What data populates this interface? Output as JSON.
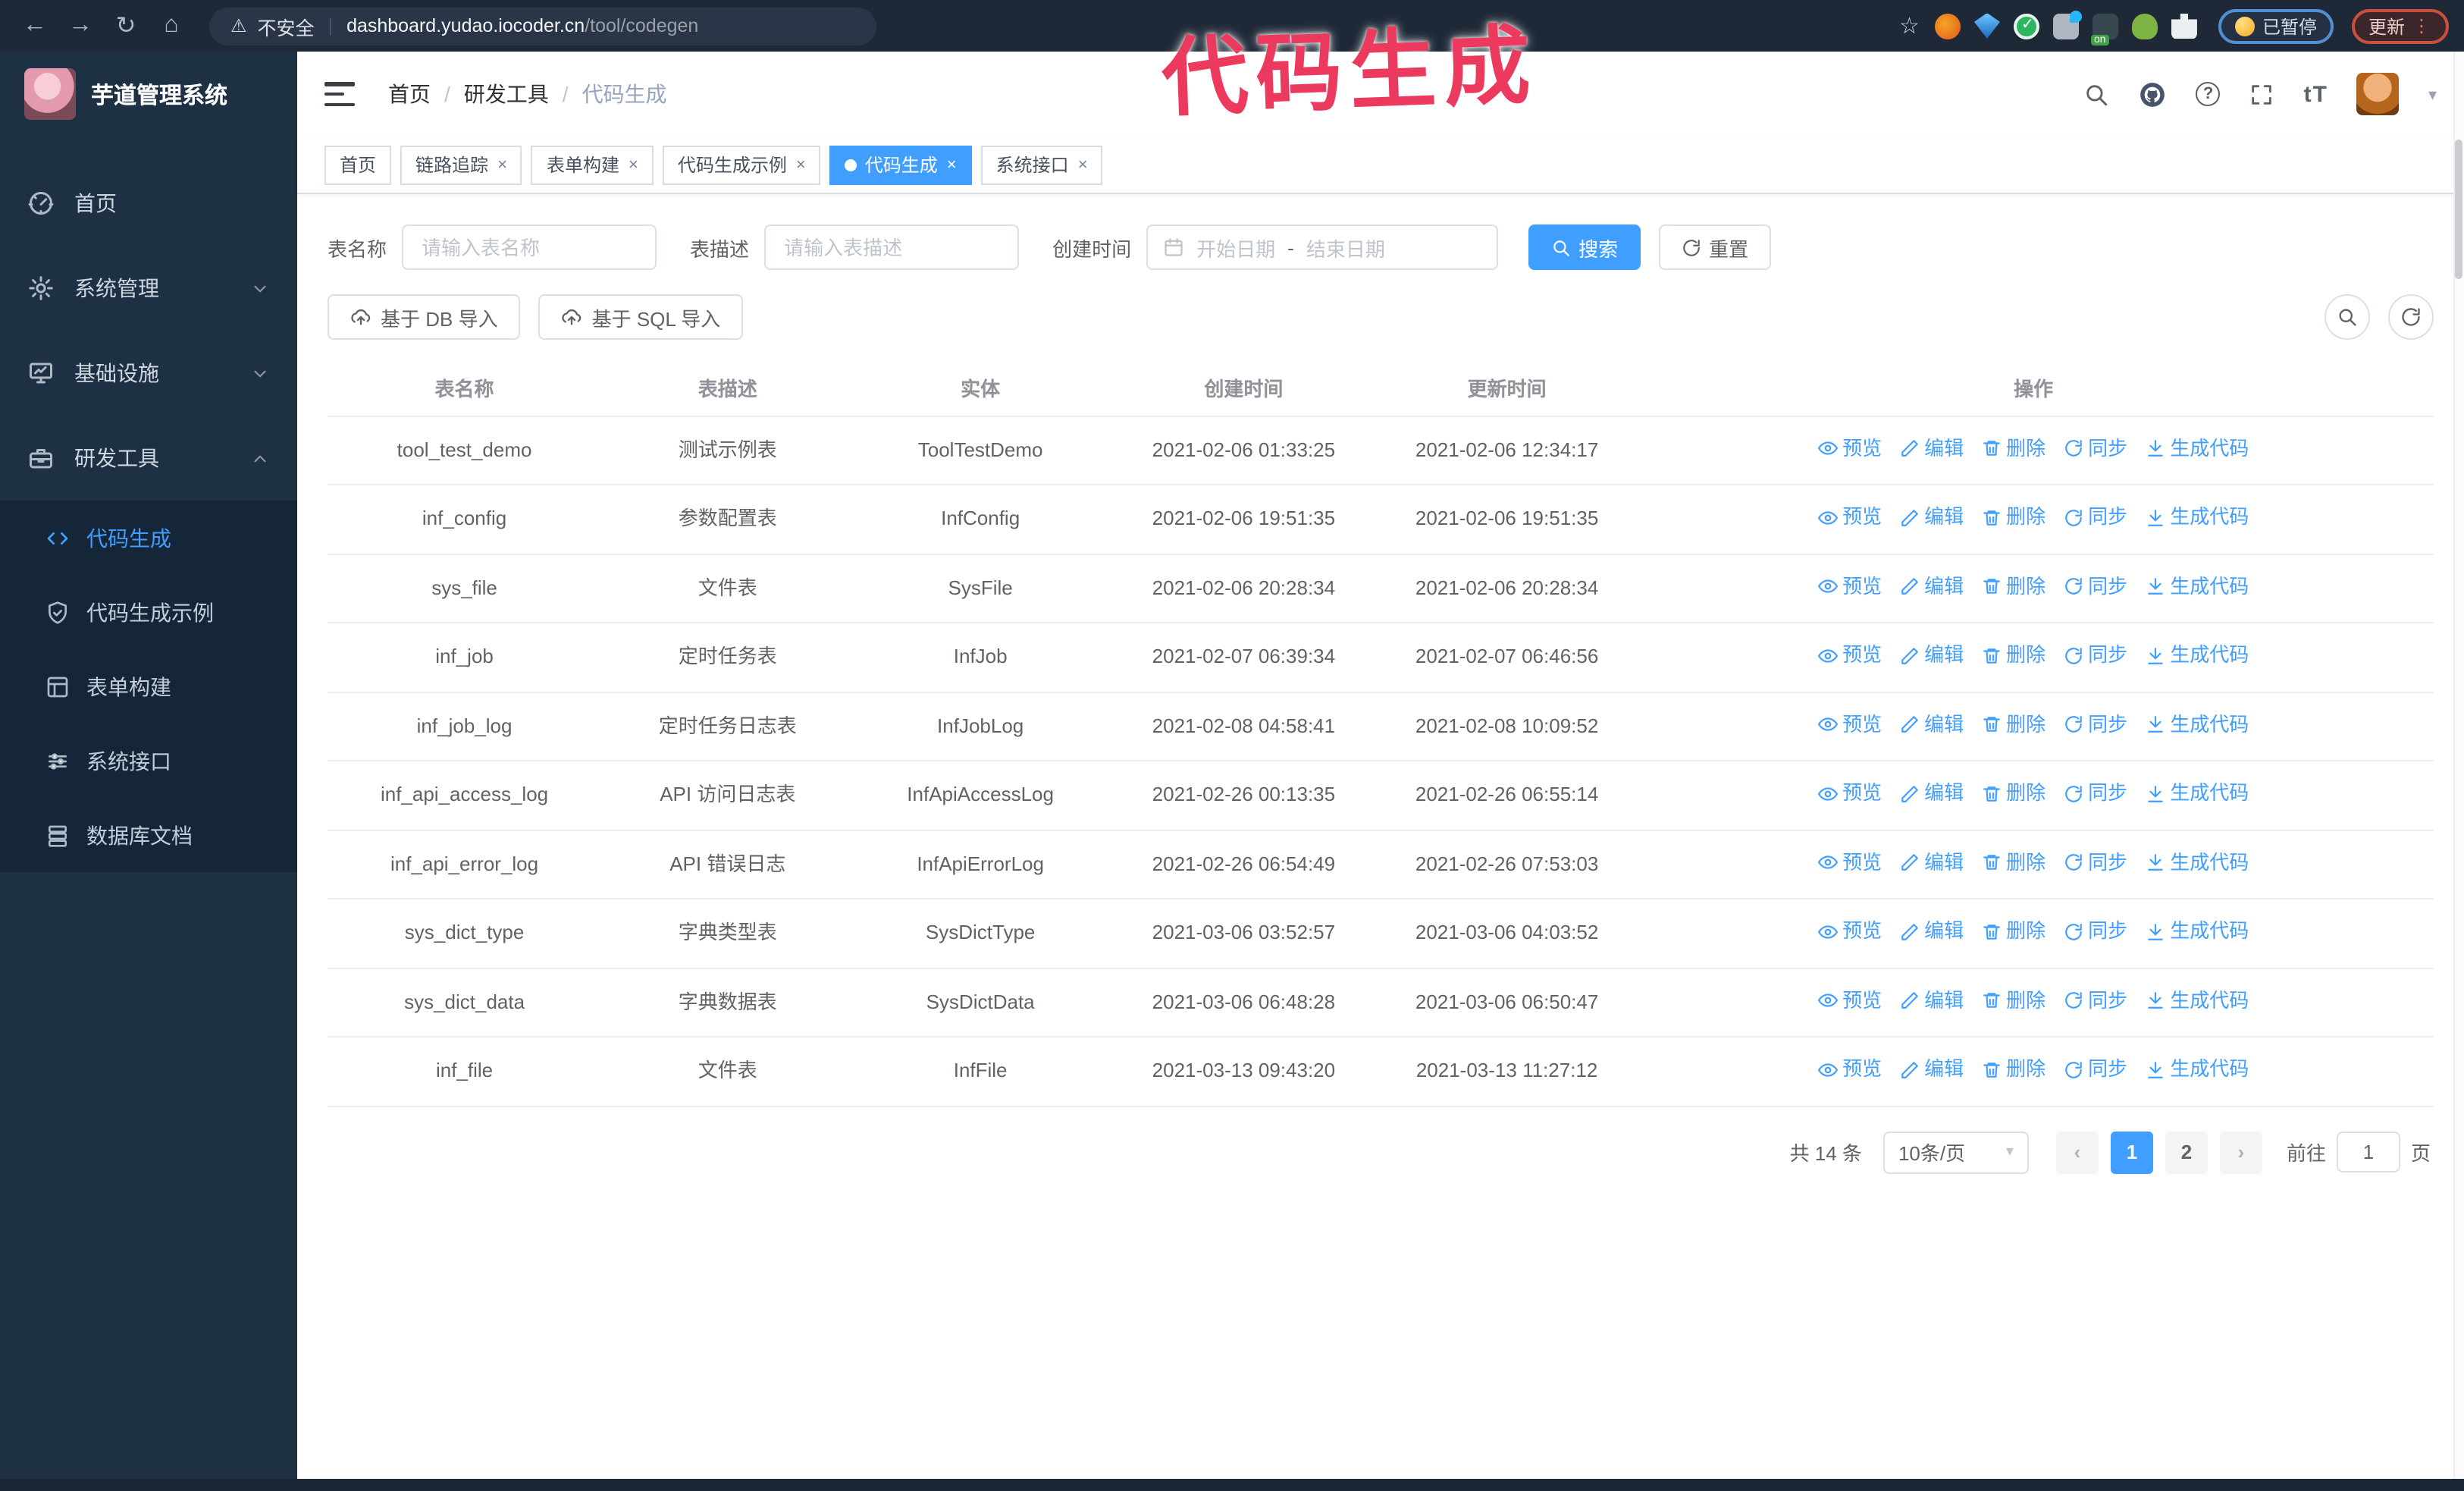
{
  "annotation": {
    "text": "代码生成",
    "color": "#ec3a5e"
  },
  "browser": {
    "security_label": "不安全",
    "url_host": "dashboard.yudao.iocoder.cn",
    "url_path": "/tool/codegen",
    "paused_badge": "已暂停",
    "update_button": "更新"
  },
  "sidebar": {
    "app_title": "芋道管理系统",
    "items": [
      {
        "label": "首页",
        "icon": "dashboard-icon",
        "expandable": false,
        "expanded": false
      },
      {
        "label": "系统管理",
        "icon": "gear-icon",
        "expandable": true,
        "expanded": false
      },
      {
        "label": "基础设施",
        "icon": "monitor-icon",
        "expandable": true,
        "expanded": false
      },
      {
        "label": "研发工具",
        "icon": "toolbox-icon",
        "expandable": true,
        "expanded": true
      }
    ],
    "subitems": [
      {
        "label": "代码生成",
        "icon": "code-icon",
        "active": true
      },
      {
        "label": "代码生成示例",
        "icon": "shield-check-icon",
        "active": false
      },
      {
        "label": "表单构建",
        "icon": "form-icon",
        "active": false
      },
      {
        "label": "系统接口",
        "icon": "sliders-icon",
        "active": false
      },
      {
        "label": "数据库文档",
        "icon": "database-icon",
        "active": false
      }
    ]
  },
  "breadcrumb": {
    "items": [
      "首页",
      "研发工具",
      "代码生成"
    ],
    "separator": "/"
  },
  "tabs": [
    {
      "label": "首页",
      "closable": false,
      "active": false
    },
    {
      "label": "链路追踪",
      "closable": true,
      "active": false
    },
    {
      "label": "表单构建",
      "closable": true,
      "active": false
    },
    {
      "label": "代码生成示例",
      "closable": true,
      "active": false
    },
    {
      "label": "代码生成",
      "closable": true,
      "active": true
    },
    {
      "label": "系统接口",
      "closable": true,
      "active": false
    }
  ],
  "filters": {
    "table_name_label": "表名称",
    "table_name_placeholder": "请输入表名称",
    "table_desc_label": "表描述",
    "table_desc_placeholder": "请输入表描述",
    "create_time_label": "创建时间",
    "date_start_placeholder": "开始日期",
    "date_separator": "-",
    "date_end_placeholder": "结束日期",
    "search_button": "搜索",
    "reset_button": "重置"
  },
  "toolbar": {
    "import_db_button": "基于 DB 导入",
    "import_sql_button": "基于 SQL 导入"
  },
  "table": {
    "columns": [
      "表名称",
      "表描述",
      "实体",
      "创建时间",
      "更新时间",
      "操作"
    ],
    "actions": [
      {
        "label": "预览",
        "icon": "eye-icon"
      },
      {
        "label": "编辑",
        "icon": "edit-icon"
      },
      {
        "label": "删除",
        "icon": "trash-icon"
      },
      {
        "label": "同步",
        "icon": "sync-icon"
      },
      {
        "label": "生成代码",
        "icon": "download-icon"
      }
    ],
    "rows": [
      {
        "name": "tool_test_demo",
        "desc": "测试示例表",
        "entity": "ToolTestDemo",
        "created": "2021-02-06 01:33:25",
        "updated": "2021-02-06 12:34:17"
      },
      {
        "name": "inf_config",
        "desc": "参数配置表",
        "entity": "InfConfig",
        "created": "2021-02-06 19:51:35",
        "updated": "2021-02-06 19:51:35"
      },
      {
        "name": "sys_file",
        "desc": "文件表",
        "entity": "SysFile",
        "created": "2021-02-06 20:28:34",
        "updated": "2021-02-06 20:28:34"
      },
      {
        "name": "inf_job",
        "desc": "定时任务表",
        "entity": "InfJob",
        "created": "2021-02-07 06:39:34",
        "updated": "2021-02-07 06:46:56"
      },
      {
        "name": "inf_job_log",
        "desc": "定时任务日志表",
        "entity": "InfJobLog",
        "created": "2021-02-08 04:58:41",
        "updated": "2021-02-08 10:09:52"
      },
      {
        "name": "inf_api_access_log",
        "desc": "API 访问日志表",
        "entity": "InfApiAccessLog",
        "created": "2021-02-26 00:13:35",
        "updated": "2021-02-26 06:55:14"
      },
      {
        "name": "inf_api_error_log",
        "desc": "API 错误日志",
        "entity": "InfApiErrorLog",
        "created": "2021-02-26 06:54:49",
        "updated": "2021-02-26 07:53:03"
      },
      {
        "name": "sys_dict_type",
        "desc": "字典类型表",
        "entity": "SysDictType",
        "created": "2021-03-06 03:52:57",
        "updated": "2021-03-06 04:03:52"
      },
      {
        "name": "sys_dict_data",
        "desc": "字典数据表",
        "entity": "SysDictData",
        "created": "2021-03-06 06:48:28",
        "updated": "2021-03-06 06:50:47"
      },
      {
        "name": "inf_file",
        "desc": "文件表",
        "entity": "InfFile",
        "created": "2021-03-13 09:43:20",
        "updated": "2021-03-13 11:27:12"
      }
    ]
  },
  "pagination": {
    "total_text": "共 14 条",
    "page_size": "10条/页",
    "pages": [
      "1",
      "2"
    ],
    "active_page": "1",
    "goto_label": "前往",
    "goto_value": "1",
    "goto_suffix": "页"
  },
  "colors": {
    "accent": "#409eff",
    "annotation": "#ec3a5e",
    "sidebar_bg": "#1e3044",
    "submenu_bg": "#142638"
  }
}
